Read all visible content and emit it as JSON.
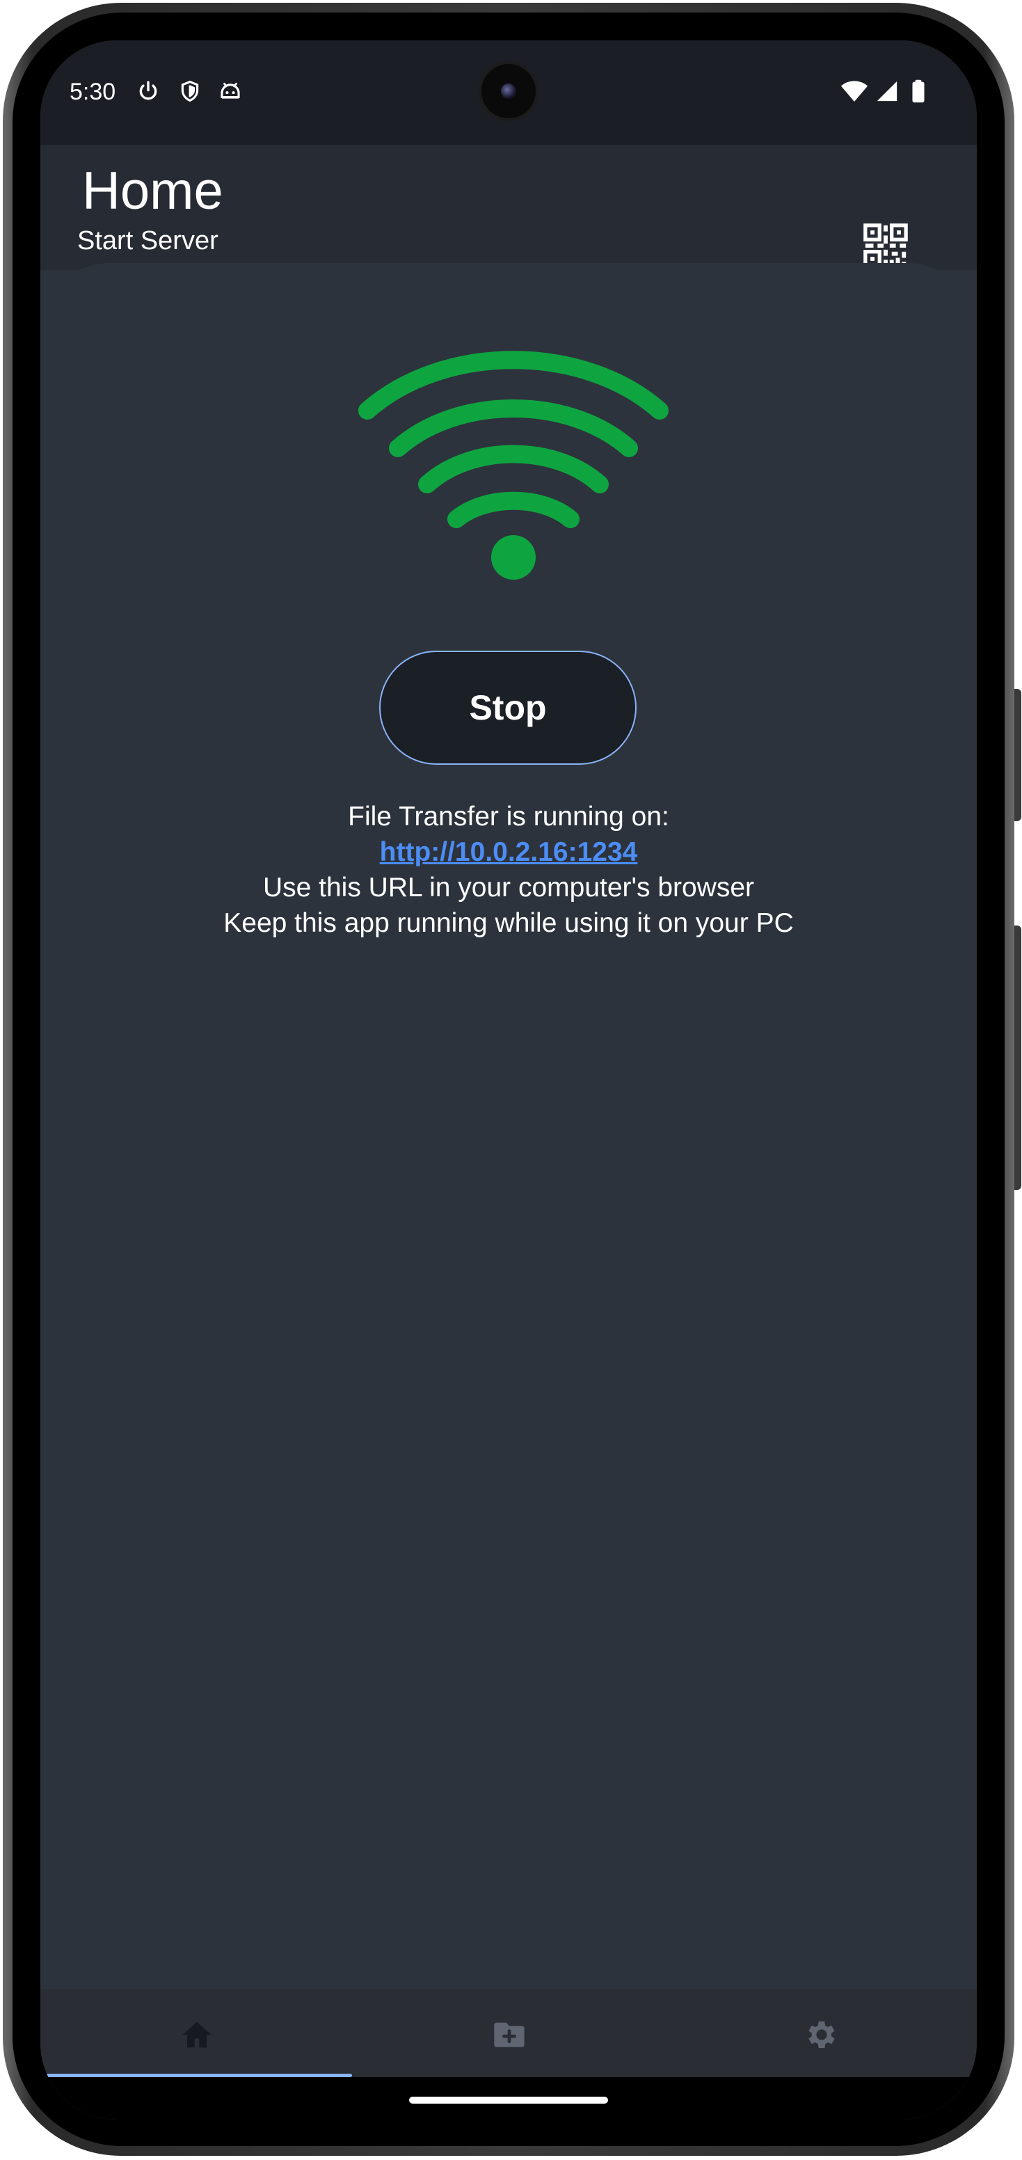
{
  "status_bar": {
    "time": "5:30",
    "left_icons": [
      "power-icon",
      "shield-icon",
      "android-icon"
    ],
    "right_icons": [
      "wifi-signal-icon",
      "cell-signal-icon",
      "battery-icon"
    ]
  },
  "app_bar": {
    "title": "Home",
    "subtitle": "Start Server",
    "action_icon": "qr-code-icon"
  },
  "server": {
    "status_icon": "wifi-icon",
    "status_color": "#0ea541",
    "button_label": "Stop",
    "running_text": "File Transfer is running on:",
    "url": "http://10.0.2.16:1234",
    "instruction_1": "Use this URL in your computer's browser",
    "instruction_2": "Keep this app running while using it on your PC"
  },
  "bottom_nav": {
    "items": [
      {
        "icon": "home-icon",
        "selected": true
      },
      {
        "icon": "create-folder-icon",
        "selected": false
      },
      {
        "icon": "settings-icon",
        "selected": false
      }
    ]
  },
  "colors": {
    "background": "#2d333c",
    "app_bar": "#272c34",
    "accent": "#8ab4f8",
    "link": "#4c8df6"
  }
}
